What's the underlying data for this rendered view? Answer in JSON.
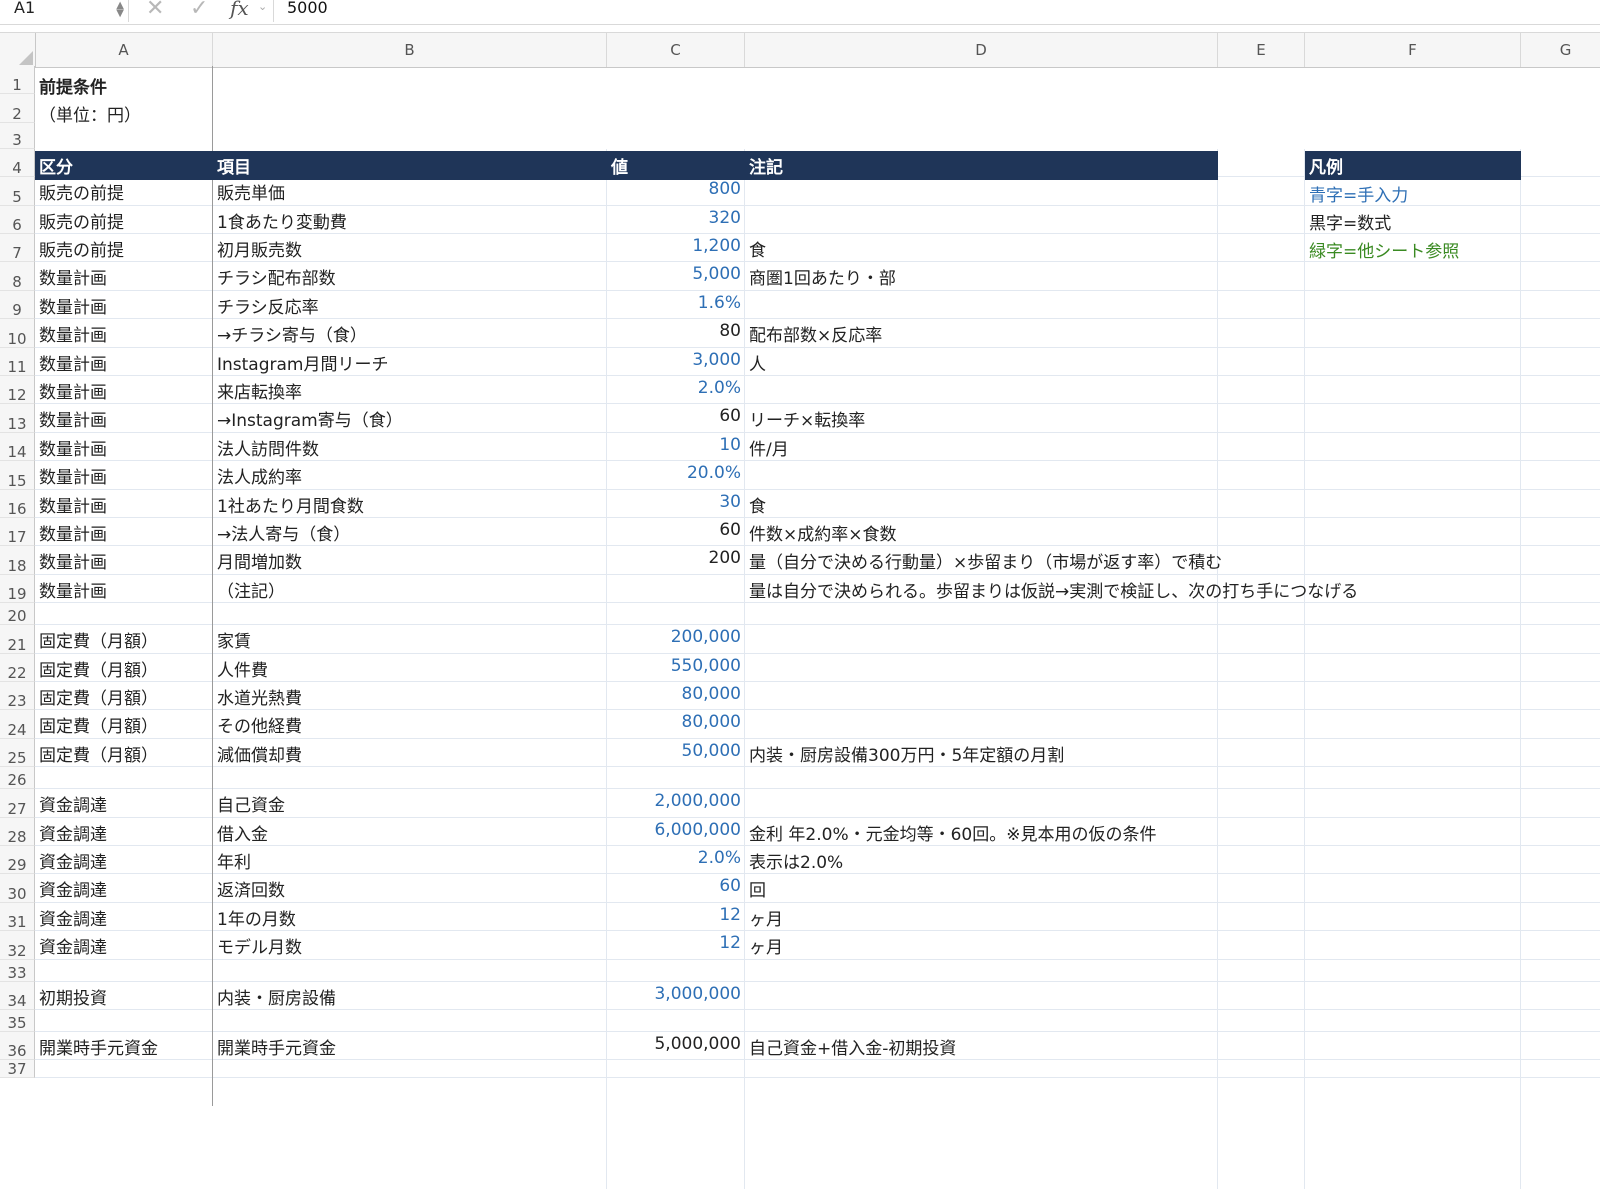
{
  "formula_bar": {
    "cell_ref": "A1",
    "cancel_icon": "✕",
    "confirm_icon": "✓",
    "fx_label": "fx",
    "formula_value": "5000"
  },
  "columns": [
    "A",
    "B",
    "C",
    "D",
    "E",
    "F",
    "G"
  ],
  "sheet": {
    "title": "前提条件",
    "unit": "（単位：円）",
    "table_headers": [
      "区分",
      "項目",
      "値",
      "注記"
    ],
    "legend_header": "凡例",
    "legend": [
      {
        "label": "青字=手入力",
        "color": "#2e6fb5"
      },
      {
        "label": "黒字=数式",
        "color": "#222222"
      },
      {
        "label": "緑字=他シート参照",
        "color": "#3a8a22"
      }
    ],
    "rows": [
      {
        "r": 5,
        "a": "販売の前提",
        "b": "販売単価",
        "c": "800",
        "d": "",
        "input": true
      },
      {
        "r": 6,
        "a": "販売の前提",
        "b": "1食あたり変動費",
        "c": "320",
        "d": "",
        "input": true
      },
      {
        "r": 7,
        "a": "販売の前提",
        "b": "初月販売数",
        "c": "1,200",
        "d": "食",
        "input": true
      },
      {
        "r": 8,
        "a": "数量計画",
        "b": "チラシ配布部数",
        "c": "5,000",
        "d": "商圏1回あたり・部",
        "input": true
      },
      {
        "r": 9,
        "a": "数量計画",
        "b": "チラシ反応率",
        "c": "1.6%",
        "d": "",
        "input": true
      },
      {
        "r": 10,
        "a": "数量計画",
        "b": "→チラシ寄与（食）",
        "c": "80",
        "d": "配布部数×反応率",
        "input": false
      },
      {
        "r": 11,
        "a": "数量計画",
        "b": "Instagram月間リーチ",
        "c": "3,000",
        "d": "人",
        "input": true
      },
      {
        "r": 12,
        "a": "数量計画",
        "b": "来店転換率",
        "c": "2.0%",
        "d": "",
        "input": true
      },
      {
        "r": 13,
        "a": "数量計画",
        "b": "→Instagram寄与（食）",
        "c": "60",
        "d": "リーチ×転換率",
        "input": false
      },
      {
        "r": 14,
        "a": "数量計画",
        "b": "法人訪問件数",
        "c": "10",
        "d": "件/月",
        "input": true
      },
      {
        "r": 15,
        "a": "数量計画",
        "b": "法人成約率",
        "c": "20.0%",
        "d": "",
        "input": true
      },
      {
        "r": 16,
        "a": "数量計画",
        "b": "1社あたり月間食数",
        "c": "30",
        "d": "食",
        "input": true
      },
      {
        "r": 17,
        "a": "数量計画",
        "b": "→法人寄与（食）",
        "c": "60",
        "d": "件数×成約率×食数",
        "input": false
      },
      {
        "r": 18,
        "a": "数量計画",
        "b": "月間増加数",
        "c": "200",
        "d": "量（自分で決める行動量）×歩留まり（市場が返す率）で積む",
        "input": false
      },
      {
        "r": 19,
        "a": "数量計画",
        "b": "（注記）",
        "c": "",
        "d": "量は自分で決められる。歩留まりは仮説→実測で検証し、次の打ち手につなげる",
        "input": false
      },
      {
        "r": 21,
        "a": "固定費（月額）",
        "b": "家賃",
        "c": "200,000",
        "d": "",
        "input": true
      },
      {
        "r": 22,
        "a": "固定費（月額）",
        "b": "人件費",
        "c": "550,000",
        "d": "",
        "input": true
      },
      {
        "r": 23,
        "a": "固定費（月額）",
        "b": "水道光熱費",
        "c": "80,000",
        "d": "",
        "input": true
      },
      {
        "r": 24,
        "a": "固定費（月額）",
        "b": "その他経費",
        "c": "80,000",
        "d": "",
        "input": true
      },
      {
        "r": 25,
        "a": "固定費（月額）",
        "b": "減価償却費",
        "c": "50,000",
        "d": "内装・厨房設備300万円・5年定額の月割",
        "input": true
      },
      {
        "r": 27,
        "a": "資金調達",
        "b": "自己資金",
        "c": "2,000,000",
        "d": "",
        "input": true
      },
      {
        "r": 28,
        "a": "資金調達",
        "b": "借入金",
        "c": "6,000,000",
        "d": "金利 年2.0%・元金均等・60回。※見本用の仮の条件",
        "input": true
      },
      {
        "r": 29,
        "a": "資金調達",
        "b": "年利",
        "c": "2.0%",
        "d": "表示は2.0%",
        "input": true
      },
      {
        "r": 30,
        "a": "資金調達",
        "b": "返済回数",
        "c": "60",
        "d": "回",
        "input": true
      },
      {
        "r": 31,
        "a": "資金調達",
        "b": "1年の月数",
        "c": "12",
        "d": "ヶ月",
        "input": true
      },
      {
        "r": 32,
        "a": "資金調達",
        "b": "モデル月数",
        "c": "12",
        "d": "ヶ月",
        "input": true
      },
      {
        "r": 34,
        "a": "初期投資",
        "b": "内装・厨房設備",
        "c": "3,000,000",
        "d": "",
        "input": true
      },
      {
        "r": 36,
        "a": "開業時手元資金",
        "b": "開業時手元資金",
        "c": "5,000,000",
        "d": "自己資金+借入金-初期投資",
        "input": false
      }
    ]
  },
  "colors": {
    "header_fill": "#1f3558",
    "input_text": "#2e6fb5",
    "reference_text": "#3a8a22"
  }
}
